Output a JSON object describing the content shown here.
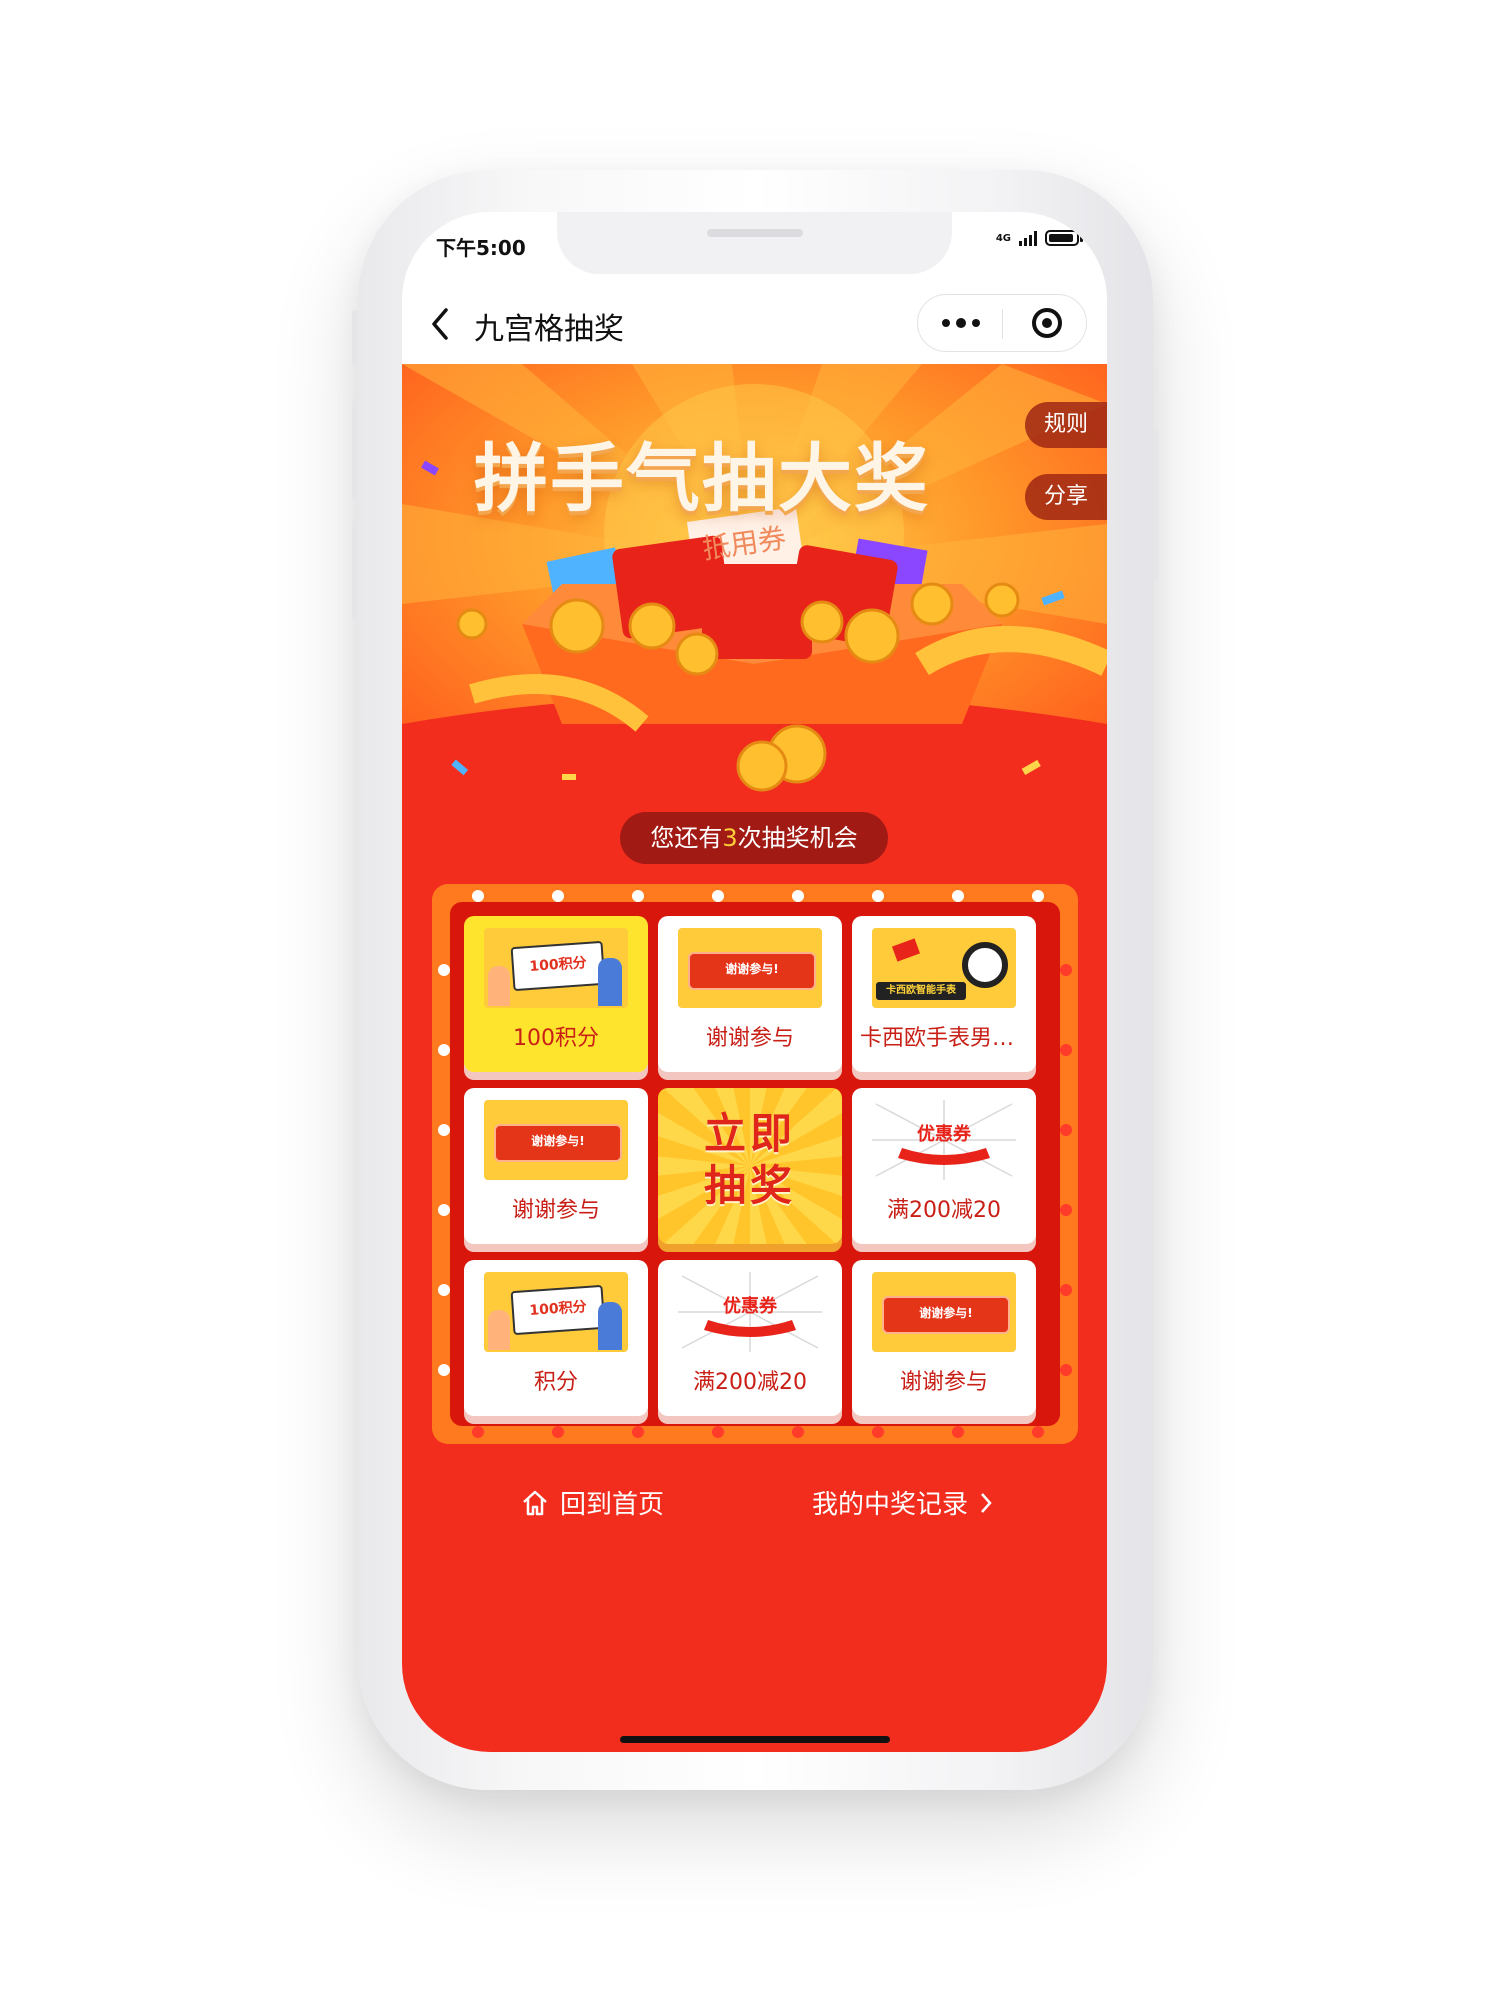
{
  "status_bar": {
    "time": "下午5:00",
    "network": "4G"
  },
  "navbar": {
    "title": "九宫格抽奖"
  },
  "banner": {
    "title": "拼手气抽大奖",
    "ticket_text": "抵用券",
    "rules_label": "规则",
    "share_label": "分享"
  },
  "chance": {
    "prefix": "您还有",
    "count": "3",
    "suffix": "次抽奖机会"
  },
  "grid": {
    "cells": [
      {
        "label": "100积分",
        "image_text": "100积分",
        "active": true
      },
      {
        "label": "谢谢参与",
        "image_text": "谢谢参与!"
      },
      {
        "label": "卡西欧手表男黑…",
        "image_text": "卡西欧智能手表"
      },
      {
        "label": "谢谢参与",
        "image_text": "谢谢参与!"
      },
      {
        "label": "满200减20",
        "image_text": "优惠券"
      },
      {
        "label": "积分",
        "image_text": "100积分"
      },
      {
        "label": "满200减20",
        "image_text": "优惠券"
      },
      {
        "label": "谢谢参与",
        "image_text": "谢谢参与!"
      }
    ],
    "draw_button": {
      "line1": "立即",
      "line2": "抽奖"
    }
  },
  "links": {
    "home": "回到首页",
    "records": "我的中奖记录"
  },
  "colors": {
    "page_red": "#f22d1e",
    "frame_orange": "#ff7a1e",
    "highlight_yellow": "#ffe42e"
  }
}
